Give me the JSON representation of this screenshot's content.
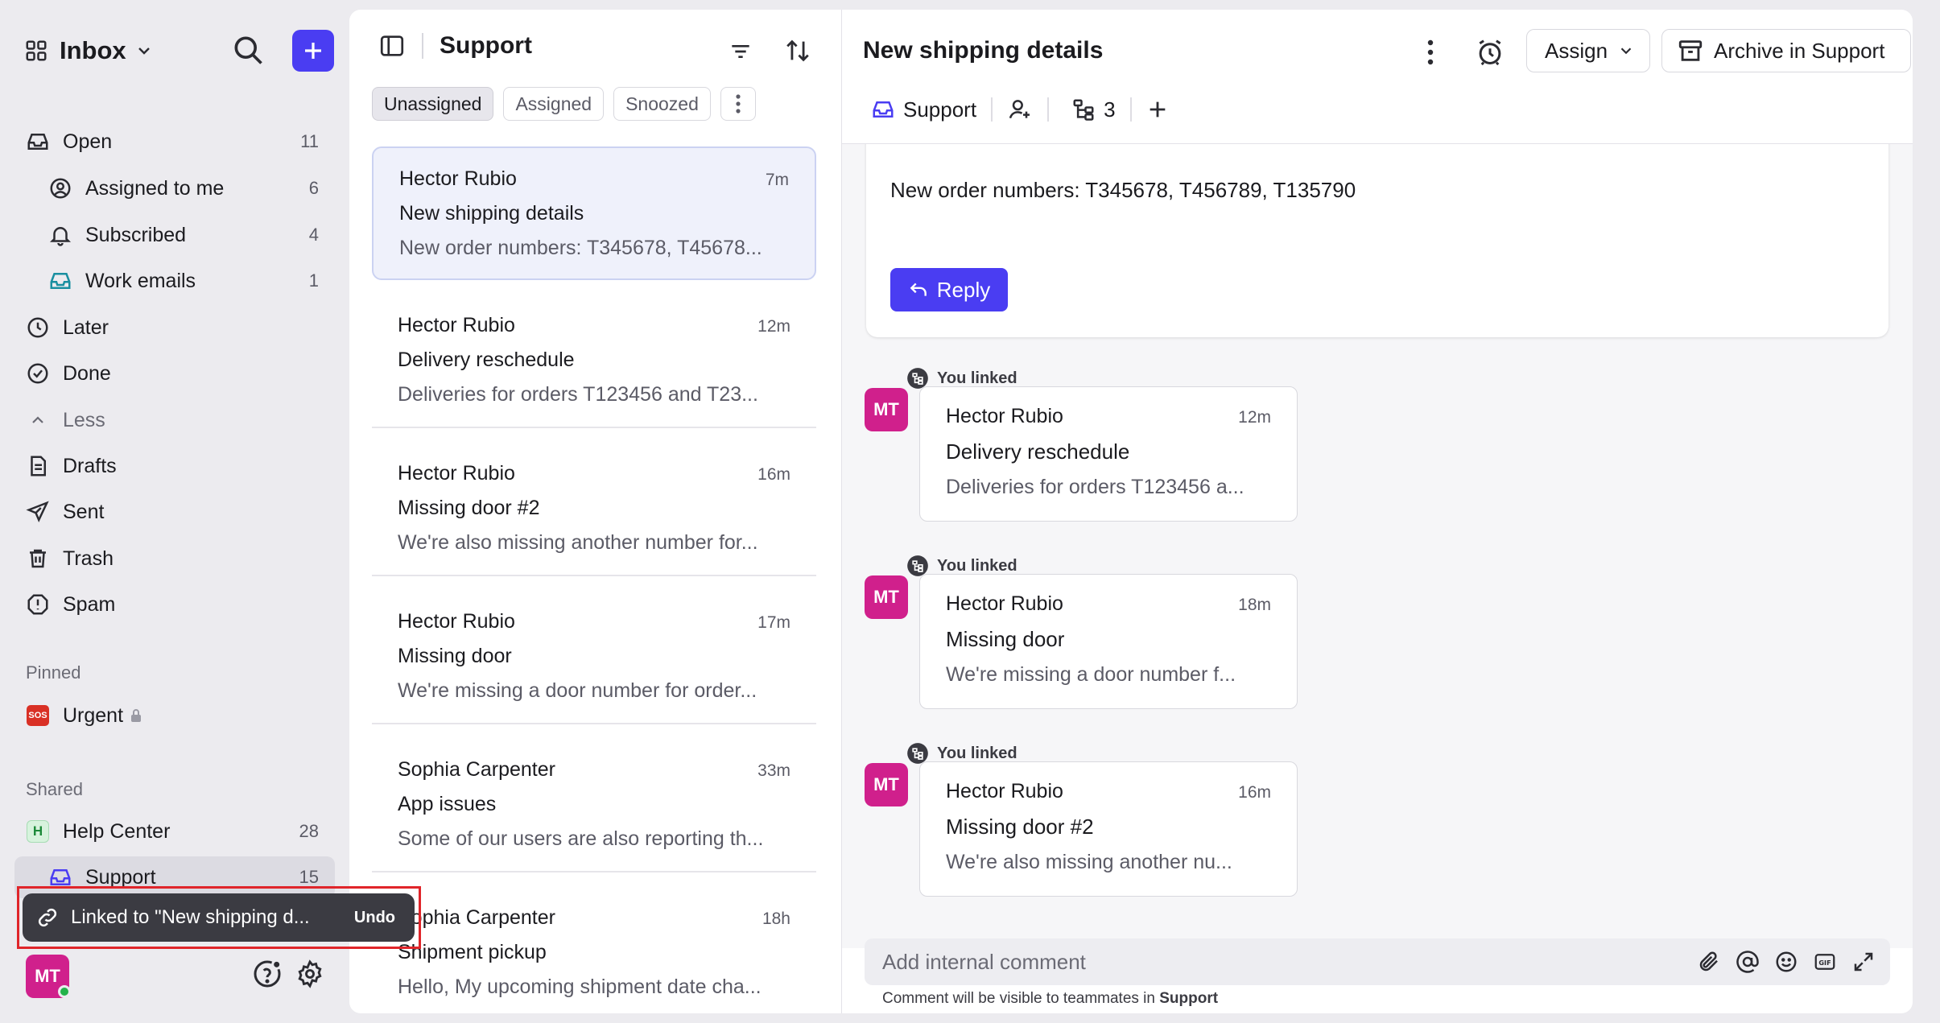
{
  "sidebar": {
    "title": "Inbox",
    "items": [
      {
        "label": "Open",
        "count": "11"
      },
      {
        "label": "Assigned to me",
        "count": "6"
      },
      {
        "label": "Subscribed",
        "count": "4"
      },
      {
        "label": "Work emails",
        "count": "1"
      },
      {
        "label": "Later",
        "count": ""
      },
      {
        "label": "Done",
        "count": ""
      },
      {
        "label": "Less",
        "count": ""
      },
      {
        "label": "Drafts",
        "count": ""
      },
      {
        "label": "Sent",
        "count": ""
      },
      {
        "label": "Trash",
        "count": ""
      },
      {
        "label": "Spam",
        "count": ""
      }
    ],
    "pinned_header": "Pinned",
    "pinned": [
      {
        "label": "Urgent",
        "badge": "SOS"
      }
    ],
    "shared_header": "Shared",
    "shared": [
      {
        "label": "Help Center",
        "count": "28",
        "badge": "H"
      },
      {
        "label": "Support",
        "count": "15"
      }
    ],
    "avatar_initials": "MT"
  },
  "toast": {
    "text": "Linked to \"New shipping d...",
    "undo": "Undo"
  },
  "list": {
    "title": "Support",
    "chips": [
      "Unassigned",
      "Assigned",
      "Snoozed"
    ],
    "conversations": [
      {
        "sender": "Hector Rubio",
        "time": "7m",
        "subject": "New shipping details",
        "preview": "New order numbers: T345678, T45678..."
      },
      {
        "sender": "Hector Rubio",
        "time": "12m",
        "subject": "Delivery reschedule",
        "preview": "Deliveries for orders T123456 and T23..."
      },
      {
        "sender": "Hector Rubio",
        "time": "16m",
        "subject": "Missing door #2",
        "preview": "We're also missing another number for..."
      },
      {
        "sender": "Hector Rubio",
        "time": "17m",
        "subject": "Missing door",
        "preview": "We're missing a door number for order..."
      },
      {
        "sender": "Sophia Carpenter",
        "time": "33m",
        "subject": "App issues",
        "preview": "Some of our users are also reporting th..."
      },
      {
        "sender": "Sophia Carpenter",
        "time": "18h",
        "subject": "Shipment pickup",
        "preview": "Hello, My upcoming shipment date cha..."
      }
    ]
  },
  "detail": {
    "title": "New shipping details",
    "assign_label": "Assign",
    "archive_label": "Archive in Support",
    "inbox_label": "Support",
    "linked_count": "3",
    "message_body": "New order numbers: T345678, T456789, T135790",
    "reply_label": "Reply",
    "linked_label": "You linked",
    "linked": [
      {
        "initials": "MT",
        "sender": "Hector Rubio",
        "time": "12m",
        "subject": "Delivery reschedule",
        "preview": "Deliveries for orders T123456 a..."
      },
      {
        "initials": "MT",
        "sender": "Hector Rubio",
        "time": "18m",
        "subject": "Missing door",
        "preview": "We're missing a door number f..."
      },
      {
        "initials": "MT",
        "sender": "Hector Rubio",
        "time": "16m",
        "subject": "Missing door #2",
        "preview": "We're also missing another nu..."
      }
    ],
    "comment_placeholder": "Add internal comment",
    "comment_note": "Comment will be visible to teammates in",
    "comment_note_inbox": "Support"
  },
  "colors": {
    "accent": "#4a3df2",
    "avatar": "#d0208c",
    "toast_highlight": "#e0252a"
  }
}
